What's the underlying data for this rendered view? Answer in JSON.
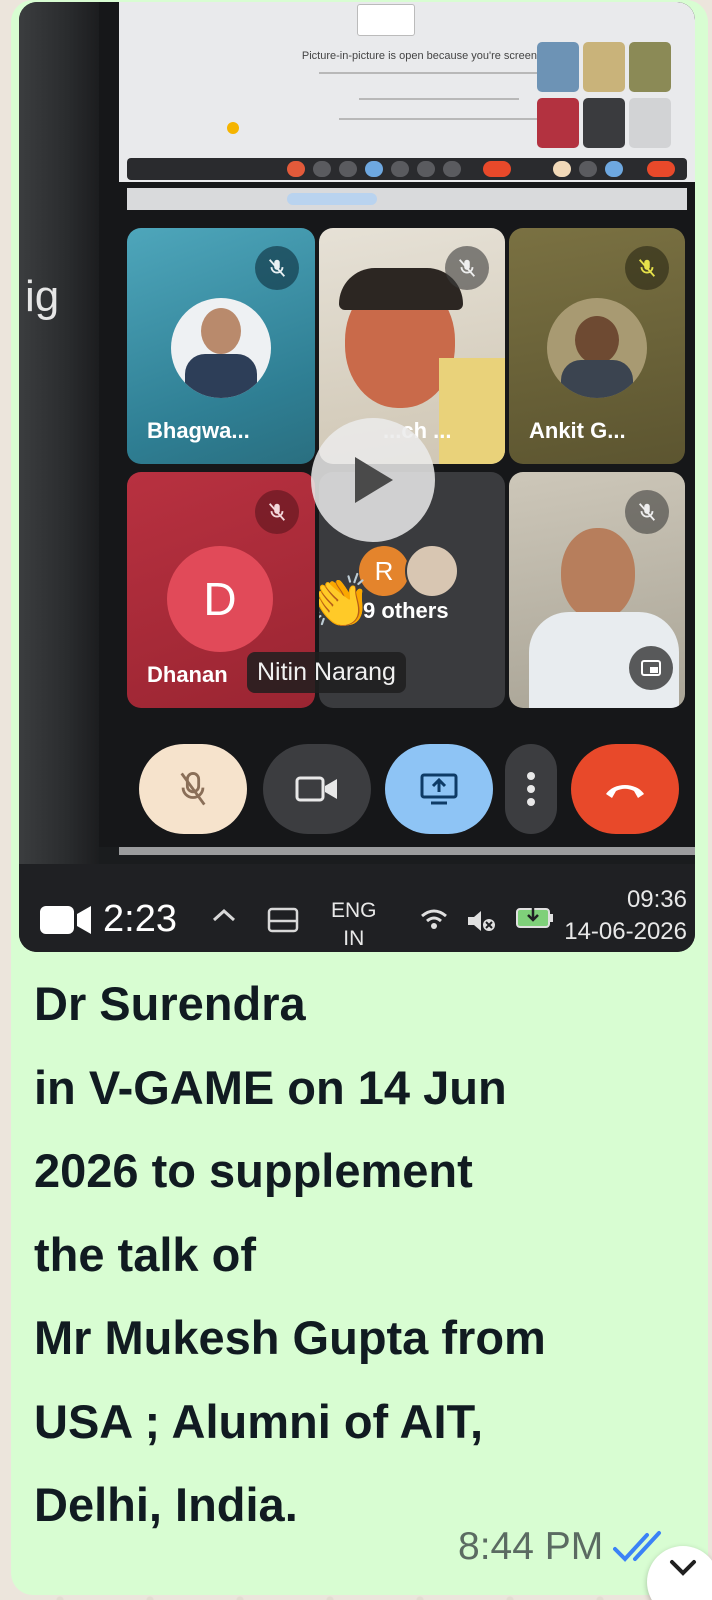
{
  "message": {
    "video": {
      "duration": "2:23",
      "pip_notice": "Picture-in-picture is open because you're screen sharing",
      "participants": [
        {
          "name": "Bhagwa...",
          "muted": true,
          "color": "#3f93a8"
        },
        {
          "name": "...ch ...",
          "muted": true,
          "color": "#d7d0c2"
        },
        {
          "name": "Ankit G...",
          "muted": true,
          "color": "#6d6538"
        },
        {
          "name": "Dhanan",
          "muted": true,
          "color": "#a52b36",
          "initial": "D"
        },
        {
          "name": "9 others",
          "muted": false,
          "color": "#3a3b3e",
          "initial": "R"
        },
        {
          "name": "",
          "muted": true,
          "color": "#c9c4b7"
        }
      ],
      "hand_raised_tooltip": "Nitin Narang",
      "edge_text": "ig",
      "taskbar": {
        "lang_line1": "ENG",
        "lang_line2": "IN",
        "clock_time": "09:36",
        "clock_date": "14-06-2026"
      },
      "controls": [
        "mic-off",
        "camera",
        "present",
        "more",
        "end-call"
      ],
      "colors": {
        "present": "#8ec4f5",
        "end_call": "#e8492a",
        "mic": "#f6e3cc"
      }
    },
    "caption_lines": [
      "Dr Surendra",
      "in V-GAME on 14 Jun",
      "2026 to supplement",
      "the talk of",
      "Mr Mukesh Gupta from",
      "USA ; Alumni of AIT,",
      "Delhi, India."
    ],
    "time": "8:44 PM",
    "status": "read",
    "status_color": "#3b82f6",
    "bubble_color": "#d8fdd2"
  }
}
